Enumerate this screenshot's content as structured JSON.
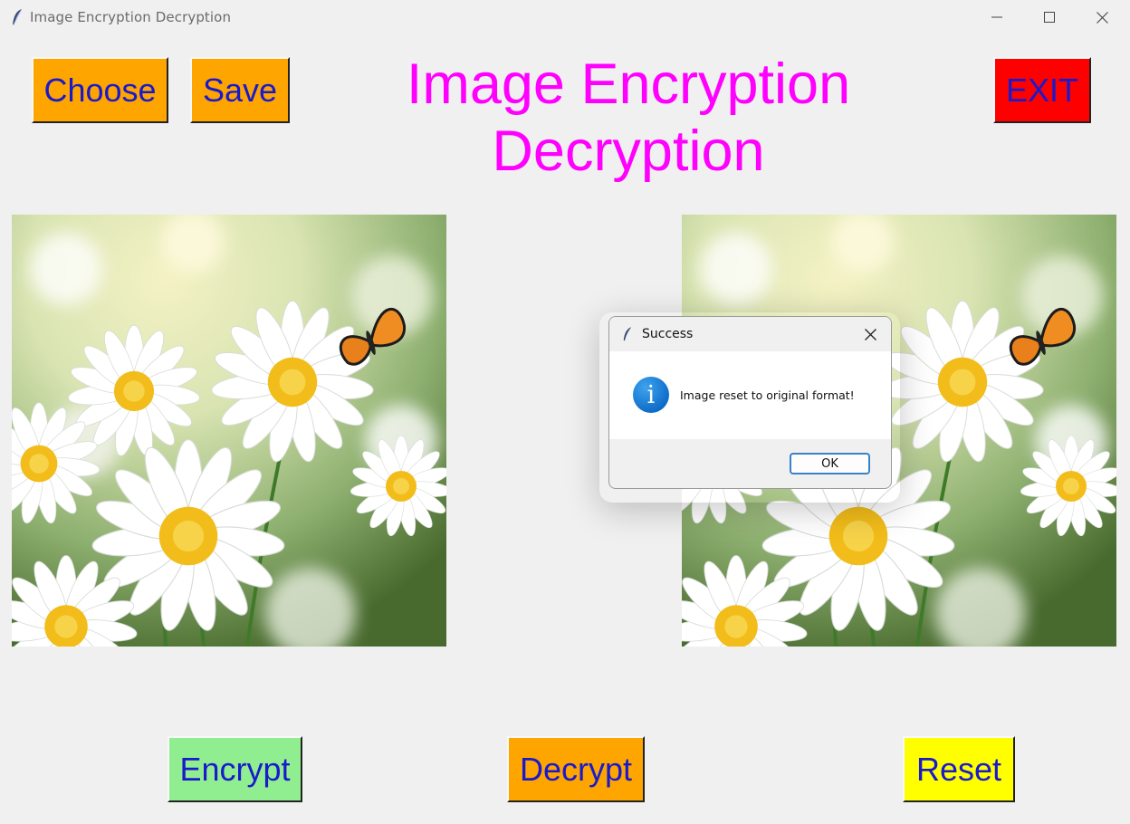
{
  "window": {
    "title": "Image Encryption Decryption"
  },
  "toolbar": {
    "choose_label": "Choose",
    "save_label": "Save",
    "exit_label": "EXIT"
  },
  "heading": {
    "line1": "Image Encryption",
    "line2": "Decryption"
  },
  "actions": {
    "encrypt_label": "Encrypt",
    "decrypt_label": "Decrypt",
    "reset_label": "Reset"
  },
  "dialog": {
    "title": "Success",
    "message": "Image reset to original format!",
    "ok_label": "OK",
    "icon": "info-icon"
  },
  "images": {
    "original": "daisy-flowers-butterfly",
    "processed": "daisy-flowers-butterfly"
  },
  "colors": {
    "heading": "#ff00ff",
    "button_text": "#1a1acc",
    "choose_bg": "#ffa500",
    "save_bg": "#ffa500",
    "exit_bg": "#ff0000",
    "encrypt_bg": "#90ee90",
    "decrypt_bg": "#ffa500",
    "reset_bg": "#ffff00"
  }
}
